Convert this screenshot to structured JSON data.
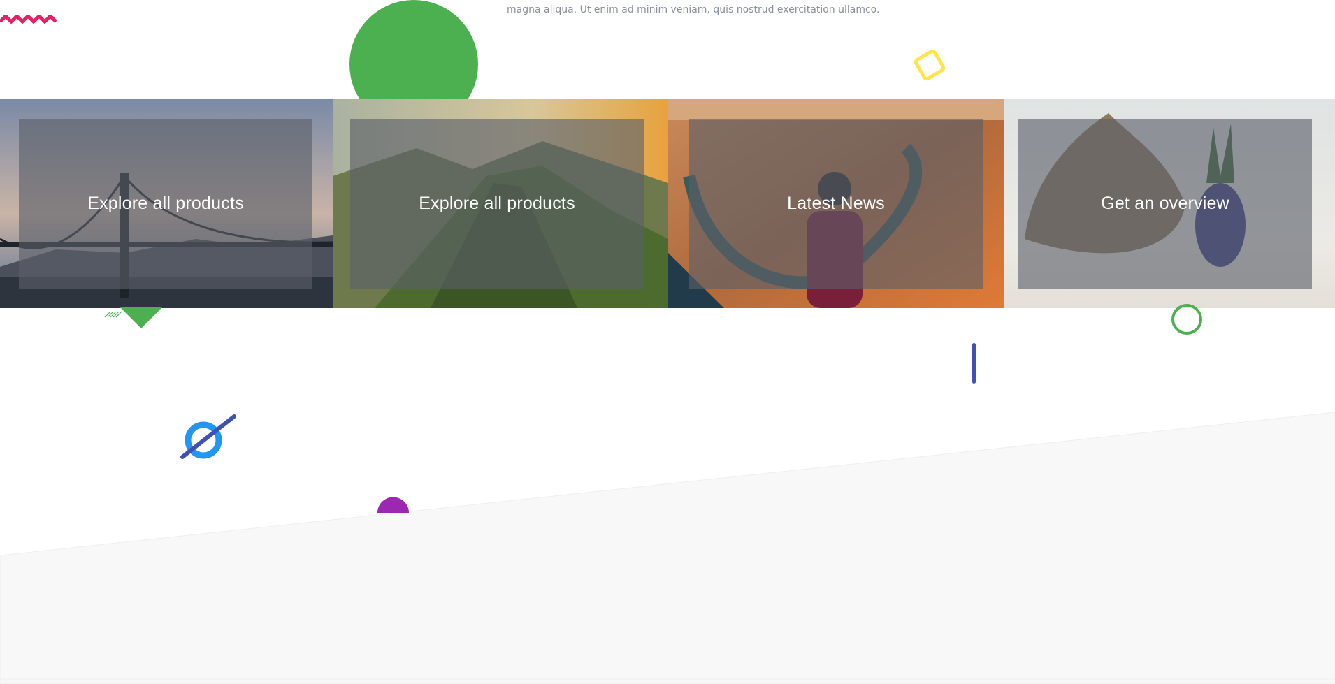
{
  "intro": {
    "text": "magna aliqua. Ut enim ad minim veniam, quis nostrud exercitation ullamco."
  },
  "tiles": [
    {
      "label": "Explore all products",
      "image": "golden-gate-bridge"
    },
    {
      "label": "Explore all products",
      "image": "mountain-ridge-hiker"
    },
    {
      "label": "Latest News",
      "image": "canyon-horseshoe-bend"
    },
    {
      "label": "Get an overview",
      "image": "driftwood-pineapple-beach"
    }
  ],
  "colors": {
    "accent_green": "#4caf50",
    "accent_yellow": "#ffe54a",
    "accent_pink": "#e91e63",
    "accent_indigo": "#3f51b5",
    "accent_blue": "#2196f3",
    "accent_purple": "#9c27b0",
    "overlay": "#5a5f69",
    "muted_text": "#8a8f99"
  }
}
